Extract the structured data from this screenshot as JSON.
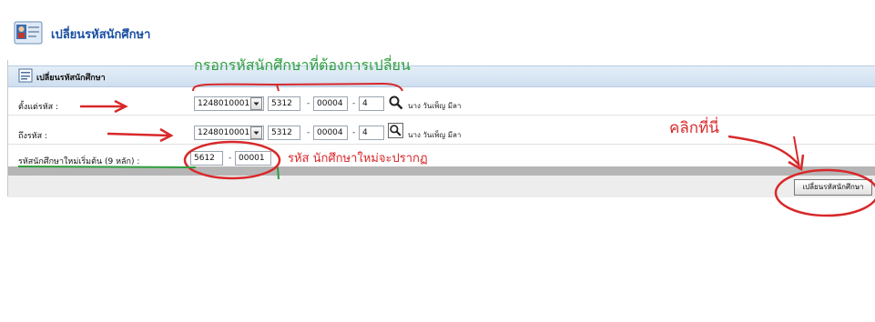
{
  "page": {
    "title": "เปลี่ยนรหัสนักศึกษา",
    "icon": "id-card-icon"
  },
  "panel": {
    "title": "เปลี่ยนรหัสนักศึกษา",
    "icon": "form-icon"
  },
  "form": {
    "from_row": {
      "label": "ตั้งแต่รหัส :",
      "prefix_select": "1248010001",
      "part2": "5312",
      "part3": "00004",
      "part4": "4",
      "student_name": "นาง วันเพ็ญ มีลา"
    },
    "to_row": {
      "label": "ถึงรหัส :",
      "prefix_select": "1248010001",
      "part2": "5312",
      "part3": "00004",
      "part4": "4",
      "student_name": "นาง วันเพ็ญ มีลา"
    },
    "new_row": {
      "label": "รหัสนักศึกษาใหม่เริ่มต้น (9 หลัก) :",
      "part1": "5612",
      "part2": "00001"
    },
    "submit_label": "เปลี่ยนรหัสนักศึกษา"
  },
  "annotations": {
    "top_note": "กรอกรหัสนักศึกษาที่ต้องการเปลี่ยน",
    "new_id_note": "รหัส  นักศึกษาใหม่จะปรากฏ",
    "click_note": "คลิกที่นี่",
    "green_color": "#2e9e3e",
    "red_color": "#d8282a"
  },
  "colors": {
    "title_blue": "#1a4fa3",
    "panel_header": "#cfdff0"
  }
}
